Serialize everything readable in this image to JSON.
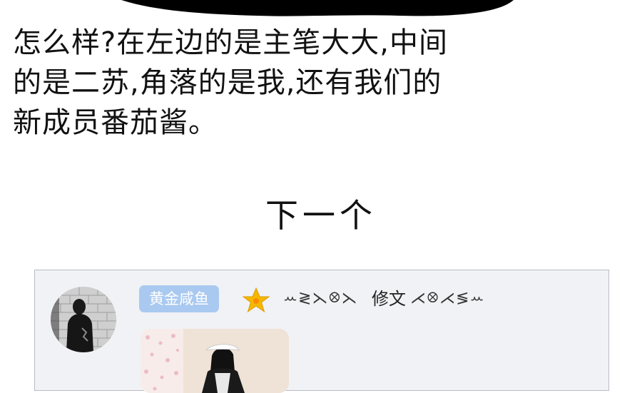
{
  "caption": {
    "line1": "怎么样?在左边的是主笔大大,中间",
    "line2": "的是二苏,角落的是我,还有我们的",
    "line3": "新成员番茄酱。"
  },
  "next_label": "下一个",
  "post": {
    "badge": "黄金咸鱼",
    "signature_left": "ꕀ≷⋋ꕕ⋋",
    "signature_text": "修文",
    "signature_right": "⋌ꕕ⋌≶ꕀ",
    "colors": {
      "card_background": "#f1f2f5",
      "badge_background": "#a9c9f0",
      "star": "#f5b800"
    },
    "icons": [
      "avatar",
      "gold-star-icon",
      "post-photo"
    ]
  }
}
